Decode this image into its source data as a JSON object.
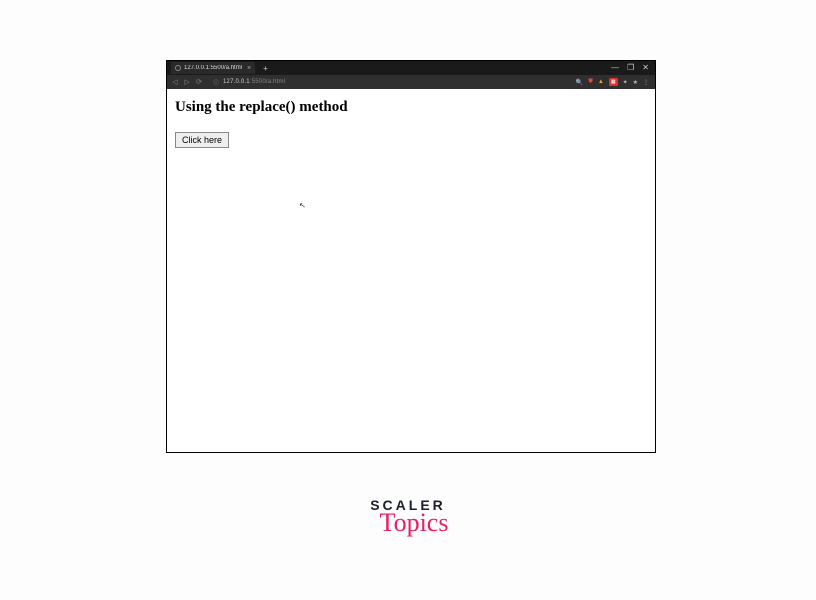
{
  "window": {
    "tab_title": "127.0.0.1:5500/a.html",
    "minimize": "—",
    "maximize": "❐",
    "close": "✕",
    "new_tab": "+"
  },
  "toolbar": {
    "back": "◁",
    "forward": "▷",
    "reload": "⟳",
    "security": "ⓘ",
    "address_host": "127.0.0.1",
    "address_path": ":5500/a.html",
    "search": "🔍",
    "shield": "⛊",
    "alert": "▲",
    "ext_box": "▦",
    "puzzle": "✦",
    "star": "★",
    "menu": "⋮"
  },
  "page": {
    "heading": "Using the replace() method",
    "button_label": "Click here"
  },
  "brand": {
    "top": "SCALER",
    "sub": "Topics"
  }
}
